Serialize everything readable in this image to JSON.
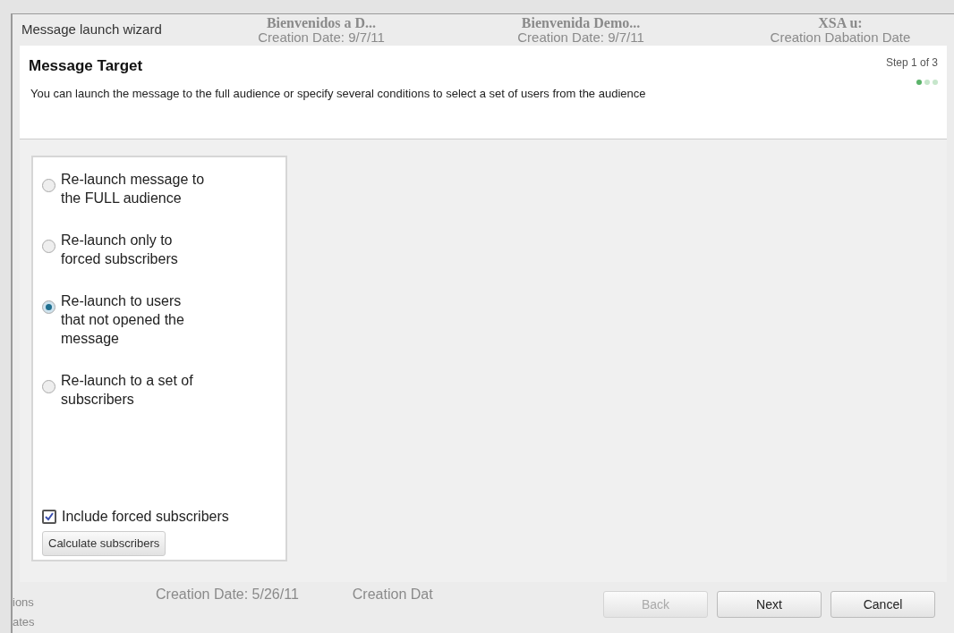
{
  "window": {
    "title": "Message launch wizard"
  },
  "background": {
    "top_cards": [
      {
        "title": "Bienvenidos a D...",
        "date": "Creation Date: 9/7/11"
      },
      {
        "title": "Bienvenida Demo...",
        "date": "Creation Date: 9/7/11"
      },
      {
        "title": "XSA u:",
        "date": "Creation Dabation Date"
      }
    ],
    "sidebar_items": [
      "ions",
      "ates"
    ],
    "bottom_cards": [
      "Creation Date: 5/26/11",
      "Creation Dat"
    ]
  },
  "header": {
    "title": "Message Target",
    "step": "Step 1 of 3",
    "description": "You can launch the message to the full audience or specify several conditions to select a set of users from the audience",
    "steps": [
      {
        "selected": true
      },
      {
        "selected": false
      },
      {
        "selected": false
      }
    ]
  },
  "options": [
    {
      "label": "Re-launch message to the FULL audience",
      "selected": false
    },
    {
      "label": "Re-launch only to forced subscribers",
      "selected": false
    },
    {
      "label": "Re-launch to users that not opened the message",
      "selected": true
    },
    {
      "label": "Re-launch to a set of subscribers",
      "selected": false
    }
  ],
  "include_forced": {
    "label": "Include forced subscribers",
    "checked": true
  },
  "calculate_button": "Calculate subscribers",
  "buttons": [
    {
      "label": "Back",
      "disabled": true
    },
    {
      "label": "Next",
      "disabled": false
    },
    {
      "label": "Cancel",
      "disabled": false
    }
  ]
}
